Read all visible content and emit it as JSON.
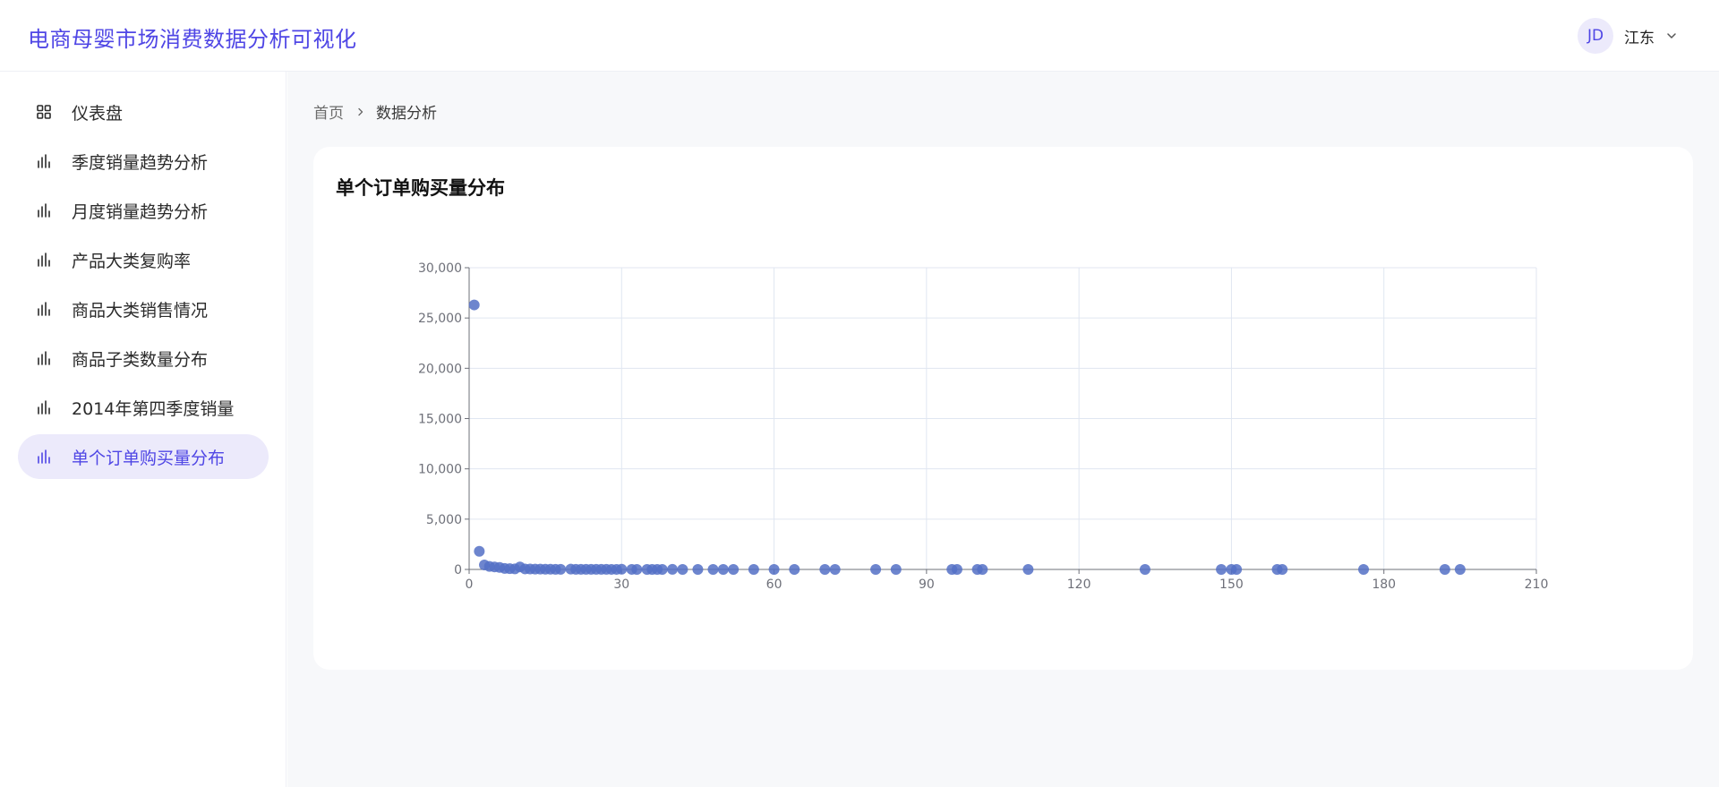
{
  "header": {
    "app_title": "电商母婴市场消费数据分析可视化",
    "user": {
      "avatar_initials": "JD",
      "name": "江东"
    }
  },
  "sidebar": {
    "items": [
      {
        "label": "仪表盘",
        "icon": "dashboard-icon",
        "active": false
      },
      {
        "label": "季度销量趋势分析",
        "icon": "bar-chart-icon",
        "active": false
      },
      {
        "label": "月度销量趋势分析",
        "icon": "bar-chart-icon",
        "active": false
      },
      {
        "label": "产品大类复购率",
        "icon": "bar-chart-icon",
        "active": false
      },
      {
        "label": "商品大类销售情况",
        "icon": "bar-chart-icon",
        "active": false
      },
      {
        "label": "商品子类数量分布",
        "icon": "bar-chart-icon",
        "active": false
      },
      {
        "label": "2014年第四季度销量",
        "icon": "bar-chart-icon",
        "active": false
      },
      {
        "label": "单个订单购买量分布",
        "icon": "bar-chart-icon",
        "active": true
      }
    ]
  },
  "breadcrumb": {
    "home": "首页",
    "current": "数据分析"
  },
  "colors": {
    "accent": "#4f46e5",
    "point": "#5470c6",
    "grid": "#e0e6f1"
  },
  "card": {
    "title": "单个订单购买量分布"
  },
  "chart_data": {
    "type": "scatter",
    "title": "单个订单购买量分布",
    "xlabel": "",
    "ylabel": "",
    "xlim": [
      0,
      210
    ],
    "ylim": [
      0,
      30000
    ],
    "x_ticks": [
      "0",
      "30",
      "60",
      "90",
      "120",
      "150",
      "180",
      "210"
    ],
    "y_ticks": [
      "0",
      "5,000",
      "10,000",
      "15,000",
      "20,000",
      "25,000",
      "30,000"
    ],
    "grid": true,
    "points": [
      [
        1,
        26300
      ],
      [
        2,
        1800
      ],
      [
        3,
        450
      ],
      [
        4,
        300
      ],
      [
        5,
        250
      ],
      [
        6,
        200
      ],
      [
        7,
        100
      ],
      [
        8,
        80
      ],
      [
        9,
        60
      ],
      [
        10,
        250
      ],
      [
        11,
        50
      ],
      [
        12,
        40
      ],
      [
        13,
        30
      ],
      [
        14,
        30
      ],
      [
        15,
        20
      ],
      [
        16,
        20
      ],
      [
        17,
        15
      ],
      [
        18,
        15
      ],
      [
        20,
        30
      ],
      [
        21,
        12
      ],
      [
        22,
        10
      ],
      [
        23,
        10
      ],
      [
        24,
        8
      ],
      [
        25,
        8
      ],
      [
        26,
        6
      ],
      [
        27,
        6
      ],
      [
        28,
        5
      ],
      [
        29,
        5
      ],
      [
        30,
        20
      ],
      [
        32,
        5
      ],
      [
        33,
        4
      ],
      [
        35,
        4
      ],
      [
        36,
        4
      ],
      [
        37,
        3
      ],
      [
        38,
        3
      ],
      [
        40,
        6
      ],
      [
        42,
        3
      ],
      [
        45,
        3
      ],
      [
        48,
        4
      ],
      [
        50,
        3
      ],
      [
        52,
        3
      ],
      [
        56,
        2
      ],
      [
        60,
        4
      ],
      [
        64,
        2
      ],
      [
        70,
        2
      ],
      [
        72,
        2
      ],
      [
        80,
        2
      ],
      [
        84,
        2
      ],
      [
        95,
        1
      ],
      [
        96,
        1
      ],
      [
        100,
        2
      ],
      [
        101,
        1
      ],
      [
        110,
        1
      ],
      [
        133,
        1
      ],
      [
        148,
        1
      ],
      [
        150,
        1
      ],
      [
        151,
        1
      ],
      [
        159,
        1
      ],
      [
        160,
        1
      ],
      [
        176,
        1
      ],
      [
        192,
        1
      ],
      [
        195,
        1
      ]
    ]
  }
}
